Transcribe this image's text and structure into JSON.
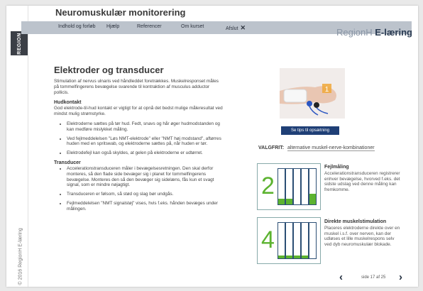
{
  "app": {
    "title": "Neuromuskulær monitorering",
    "logo_text": "REGION",
    "copyright": "© 2016 RegionH E-læring"
  },
  "nav": {
    "items": [
      "Indhold og forløb",
      "Hjælp",
      "Referencer",
      "Om kurset",
      "Afslut"
    ]
  },
  "brand": {
    "region": "RegionH",
    "elearning": "E-læring"
  },
  "content": {
    "heading": "Elektroder og transducer",
    "intro": "Stimulation af nervus ulnaris ved håndleddet foretrækkes. Muskelresponset måles på tommelfingerens bevægelse svarende til kontraktion af musculus adductor pollicis.",
    "section1": {
      "heading": "Hudkontakt",
      "text": "God elektrode-til-hud kontakt er vigtigt for at opnå det bedst mulige måleresultat ved mindst mulig strømstyrke.",
      "bullets": [
        "Elektroderne sættes på tør hud. Fedt, snavs og hår øger hudmodstanden og kan medføre mislykket måling.",
        "Ved fejlmeddelelsen \"Løs NMT-elektrode\" eller \"NMT høj modstand\", aftørres huden med en spritswab, og elektroderne sættes på, når huden er tør.",
        "Elektrodefejl kan også skyldes, at gelen på elektroderne er udtørret."
      ]
    },
    "section2": {
      "heading": "Transducer",
      "bullets": [
        "Accelerationstransduceren måler i bevægelsesretningen. Den skal derfor monteres, så den flade side bevæger sig i planet for tommelfingerens bevægelse. Monteres den så den bevæger sig sidelæns, fås kun et svagt signal, som er mindre nøjagtigt.",
        "Transduceren er følsom, så stød og slag bør undgås.",
        "Fejlmeddelelsen \"NMT signalstøj\" vises, hvis f.eks. hånden bevæges under målingen."
      ]
    }
  },
  "photo_number": "1",
  "tips_button": "Se tips til opsætning",
  "valgfrit": {
    "label": "VALGFRIT:",
    "link": "alternative muskel-nerve-kombinationer"
  },
  "cards": [
    {
      "number": "2",
      "title": "Fejlmåling",
      "text": "Accelerationstransduceren registrerer enhver bevægelse, hvorved f.eks. det sidste udslag ved denne måling kan fremkomme.",
      "fills": [
        0.15,
        0.15,
        0,
        0,
        0.3
      ]
    },
    {
      "number": "4",
      "title": "Direkte muskelstimulation",
      "text": "Placeres elektroderne direkte over en muskel i.s.f. over nerven, kan der udløses et lille muskelrespons selv ved dyb neuromuskulær blokade.",
      "fills": [
        0.08,
        0.08,
        0.08,
        0.08,
        0
      ]
    }
  ],
  "pager": {
    "prev": "‹",
    "next": "›",
    "page": "side 17 af 25"
  },
  "colors": {
    "nav": "#bcc3cc",
    "accent": "#5cb330",
    "button": "#1f3f76"
  }
}
